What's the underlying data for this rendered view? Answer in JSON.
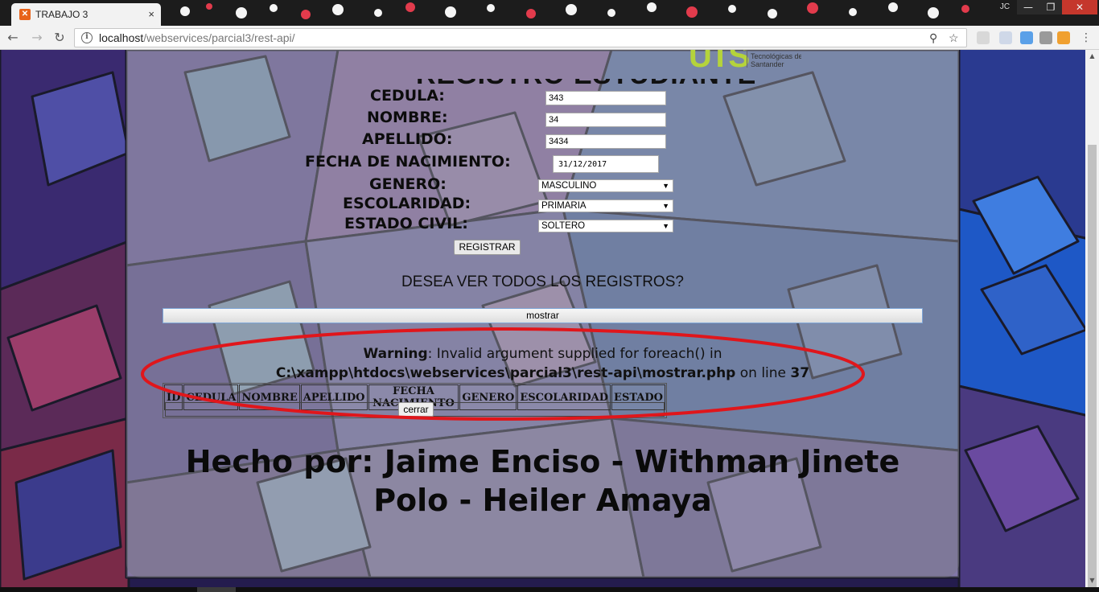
{
  "browser": {
    "tab_title": "TRABAJO 3",
    "tab_close": "×",
    "url_host": "localhost",
    "url_path": "/webservices/parcial3/rest-api/",
    "user_initials": "JC",
    "back_icon": "arrow-left-icon",
    "forward_icon": "arrow-right-icon",
    "reload_icon": "reload-icon",
    "zoom_icon": "magnifier-icon",
    "bookmark_icon": "star-icon"
  },
  "window_controls": {
    "minimize": "—",
    "maximize": "❐",
    "close": "✕"
  },
  "heading": {
    "partial_text": "REGISTRO ESTUDIANTE"
  },
  "logo": {
    "mark": "UTS",
    "subtitle": "Tecnológicas de Santander"
  },
  "form": {
    "cedula_label": "CEDULA:",
    "cedula_value": "343",
    "nombre_label": "NOMBRE:",
    "nombre_value": "34",
    "apellido_label": "APELLIDO:",
    "apellido_value": "3434",
    "fecha_label": "FECHA DE NACIMIENTO:",
    "fecha_value": "31/12/2017",
    "genero_label": "GENERO:",
    "genero_value": "MASCULINO",
    "escolaridad_label": "ESCOLARIDAD:",
    "escolaridad_value": "PRIMARIA",
    "estado_label": "ESTADO CIVIL:",
    "estado_value": "SOLTERO",
    "submit_label": "REGISTRAR"
  },
  "records": {
    "question": "DESEA VER TODOS LOS REGISTROS?",
    "show_button": "mostrar",
    "close_button": "cerrar",
    "columns": [
      "ID",
      "CEDULA",
      "NOMBRE",
      "APELLIDO",
      "FECHA NACIMIENTO",
      "GENERO",
      "ESCOLARIDAD",
      "ESTADO"
    ]
  },
  "warning": {
    "label": "Warning",
    "message": ": Invalid argument supplied for foreach() in",
    "file": "C:\\xampp\\htdocs\\webservices\\parcial3\\rest-api\\mostrar.php",
    "on_line": " on line ",
    "line": "37"
  },
  "footer": {
    "line1": "Hecho por: Jaime Enciso - Withman Jinete",
    "line2": "Polo - Heiler Amaya"
  },
  "colors": {
    "annotation_ellipse": "#e0161b",
    "logo_green": "#b5d33b",
    "close_button": "#c5372c"
  }
}
